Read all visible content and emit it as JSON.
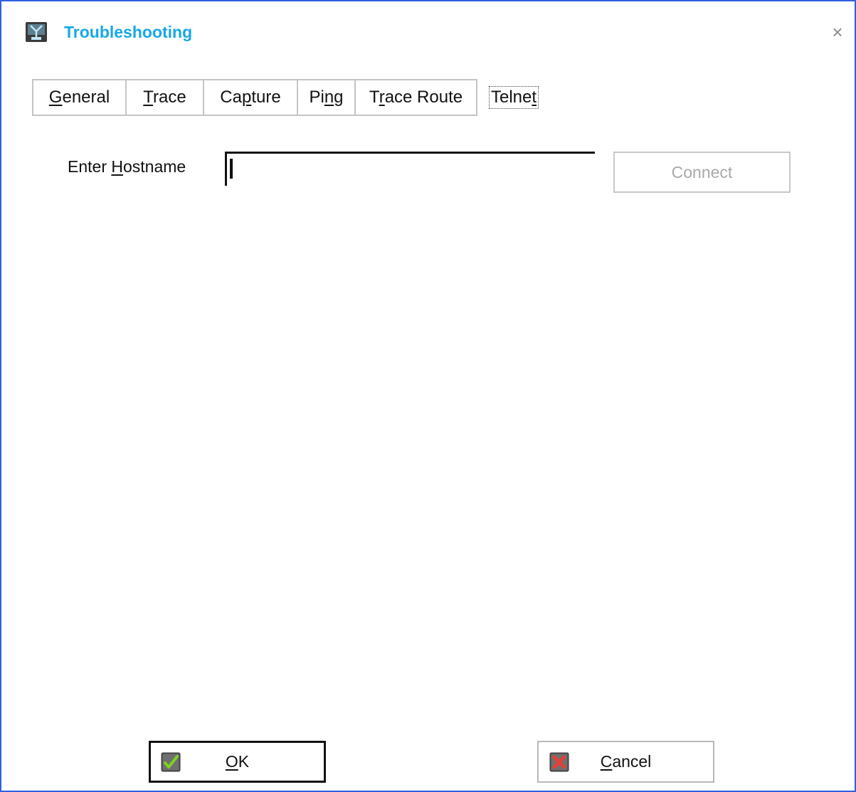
{
  "window": {
    "title": "Troubleshooting",
    "title_icon": "network-diagnostic-icon",
    "close_glyph": "×",
    "accent_color": "#2f5fe0",
    "title_color": "#17a8e6"
  },
  "tabs": [
    {
      "pre": "",
      "mn": "G",
      "post": "eneral"
    },
    {
      "pre": "",
      "mn": "T",
      "post": "race"
    },
    {
      "pre": "Ca",
      "mn": "p",
      "post": "ture"
    },
    {
      "pre": "Pi",
      "mn": "n",
      "post": "g"
    },
    {
      "pre": "T",
      "mn": "r",
      "post": "ace Route"
    },
    {
      "pre": "Telne",
      "mn": "t",
      "post": ""
    }
  ],
  "active_tab": "Telnet",
  "telnet": {
    "hostname_label_pre": "Enter ",
    "hostname_label_mn": "H",
    "hostname_label_post": "ostname",
    "hostname_value": "",
    "connect_label": "Connect"
  },
  "footer": {
    "ok_mn": "O",
    "ok_post": "K",
    "ok_icon": "check-icon",
    "cancel_mn": "C",
    "cancel_post": "ancel",
    "cancel_icon": "cross-icon"
  }
}
